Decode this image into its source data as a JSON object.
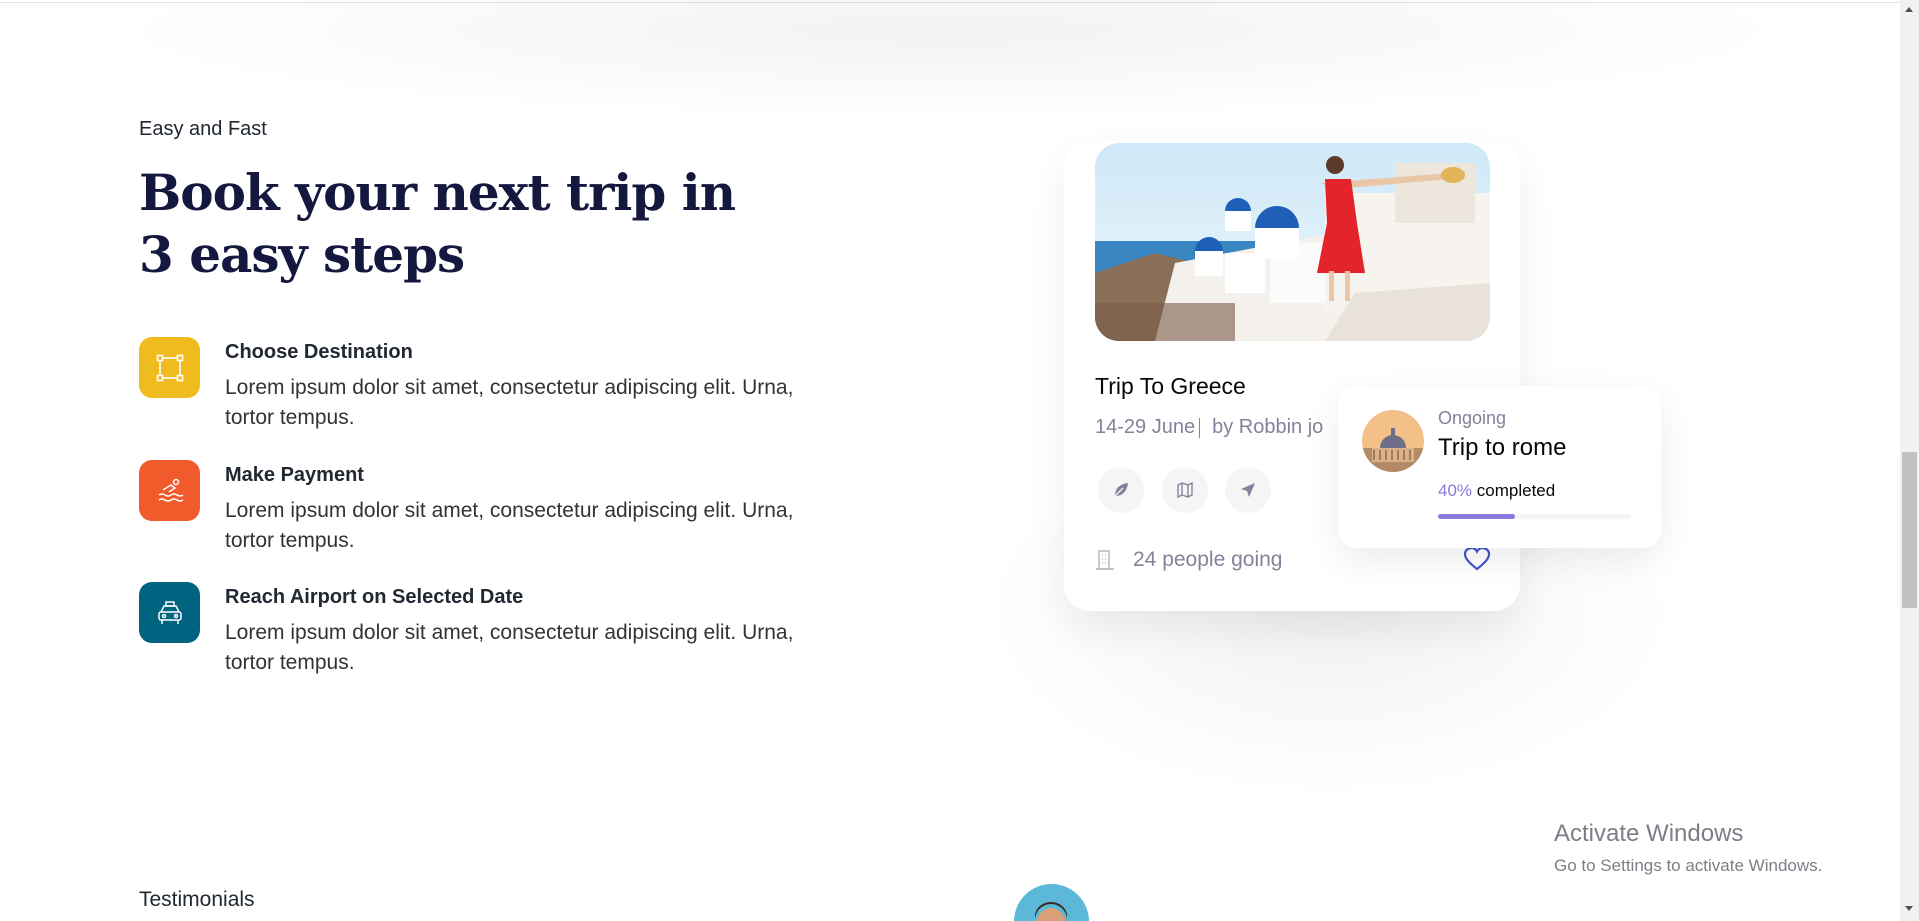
{
  "section": {
    "eyebrow": "Easy and Fast",
    "heading": "Book your next trip in 3 easy steps"
  },
  "steps": [
    {
      "title": "Choose Destination",
      "description": "Lorem ipsum dolor sit amet, consectetur adipiscing elit. Urna, tortor tempus.",
      "icon": "selection-icon",
      "color": "#f0bb1f"
    },
    {
      "title": "Make Payment",
      "description": "Lorem ipsum dolor sit amet, consectetur adipiscing elit. Urna, tortor tempus.",
      "icon": "water-sport-icon",
      "color": "#f15a2b"
    },
    {
      "title": "Reach Airport on Selected Date",
      "description": "Lorem ipsum dolor sit amet, consectetur adipiscing elit. Urna, tortor tempus.",
      "icon": "taxi-icon",
      "color": "#006380"
    }
  ],
  "trip_card": {
    "title": "Trip To Greece",
    "dates": "14-29 June",
    "author": "by Robbin jo",
    "people": "24 people going",
    "icons": [
      "leaf-icon",
      "map-icon",
      "send-icon"
    ]
  },
  "ongoing_card": {
    "status": "Ongoing",
    "title": "Trip to rome",
    "percent": "40%",
    "completed_label": "completed",
    "progress": 0.4,
    "accent": "#8a79df"
  },
  "testimonials": {
    "eyebrow": "Testimonials"
  },
  "watermark": {
    "line1": "Activate Windows",
    "line2": "Go to Settings to activate Windows."
  }
}
